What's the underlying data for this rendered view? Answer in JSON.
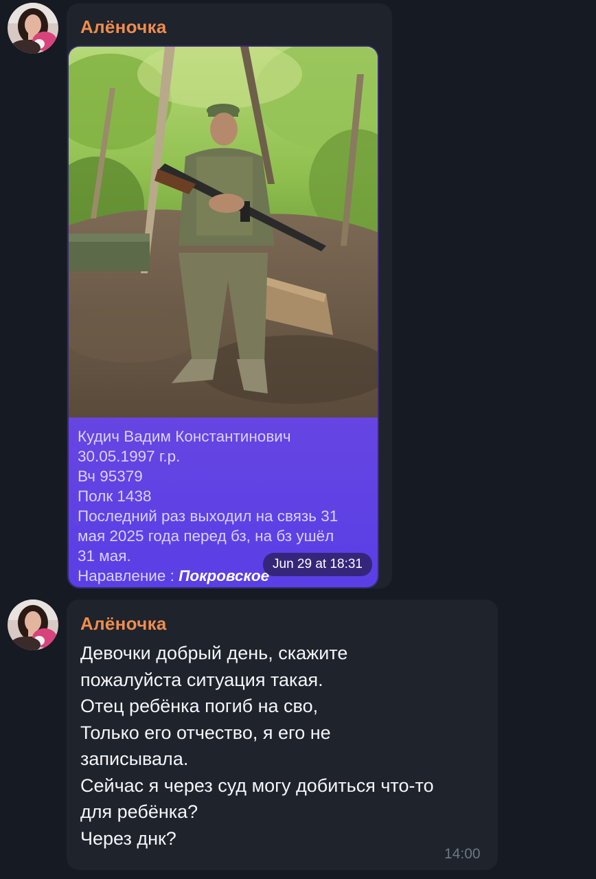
{
  "messages": [
    {
      "sender": "Алёночка",
      "type": "photo",
      "caption_lines": [
        "Кудич Вадим Константинович",
        "30.05.1997 г.р.",
        "Вч 95379",
        "Полк 1438",
        "Последний раз выходил на связь 31",
        "мая 2025 года перед бз, на бз ушёл",
        "31 мая."
      ],
      "caption_last_prefix": "Наравление : ",
      "caption_last_bold": "Покровское",
      "timestamp": "Jun 29 at 18:31"
    },
    {
      "sender": "Алёночка",
      "type": "text",
      "lines": [
        "Девочки добрый день, скажите",
        "пожалуйста ситуация такая.",
        "Отец ребёнка погиб на сво,",
        "Только его отчество, я его не",
        "записывала.",
        "Сейчас я через суд могу добиться что-то",
        "для ребёнка?",
        "Через днк?"
      ],
      "timestamp": "14:00"
    }
  ],
  "colors": {
    "background": "#151a23",
    "bubble": "#1e232c",
    "sender_name": "#f08c4d",
    "caption_card": "#6b48e0"
  }
}
